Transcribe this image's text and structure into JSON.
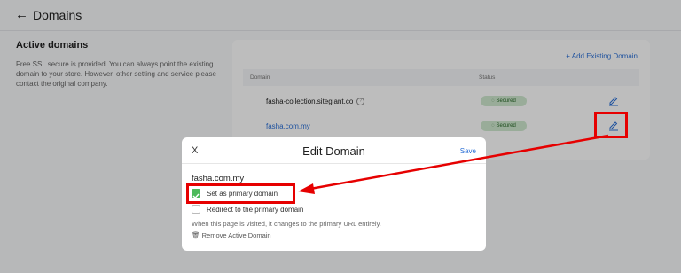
{
  "header": {
    "back_glyph": "←",
    "title": "Domains"
  },
  "section": {
    "title": "Active domains",
    "description": "Free SSL secure is provided. You can always point the existing domain to your store. However, other setting and service please contact the original company."
  },
  "card": {
    "add_label": "+ Add Existing Domain",
    "columns": [
      "Domain",
      "Status"
    ],
    "rows": [
      {
        "domain": "fasha-collection.sitegiant.co",
        "help_glyph": "?",
        "status": "Secured",
        "status_glyph": "◌",
        "link": false
      },
      {
        "domain": "fasha.com.my",
        "status": "Secured",
        "status_glyph": "◌",
        "link": true
      }
    ]
  },
  "modal": {
    "close_glyph": "X",
    "title": "Edit Domain",
    "save_label": "Save",
    "domain": "fasha.com.my",
    "options": [
      {
        "label": "Set as primary domain",
        "checked": true
      },
      {
        "label": "Redirect to the primary domain",
        "checked": false
      }
    ],
    "hint": "When this page is visited, it changes to the primary URL entirely.",
    "remove_label": "Remove Active Domain",
    "remove_glyph": "🗑"
  },
  "colors": {
    "accent": "#2a6fd6",
    "annotation": "#e60000",
    "success": "#4cba5a"
  }
}
